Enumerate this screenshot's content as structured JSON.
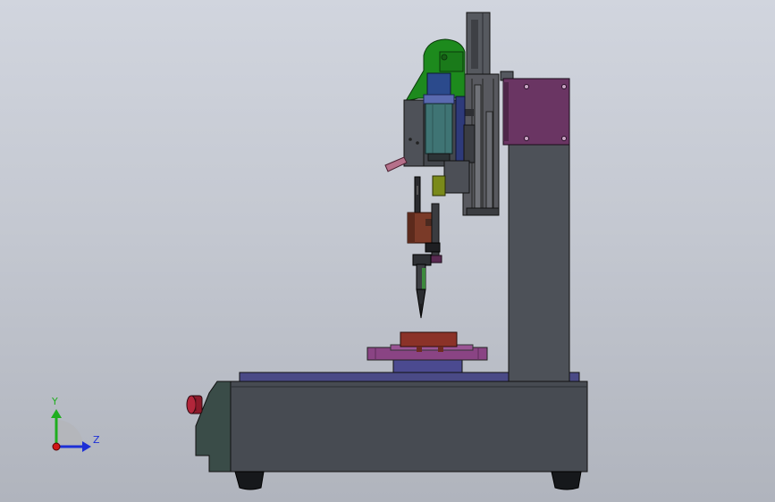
{
  "viewport": {
    "background_top": "#d1d5de",
    "background_bottom": "#b0b4bd"
  },
  "triad": {
    "y_label": "Y",
    "z_label": "Z",
    "y_color": "#1fae1f",
    "z_color": "#1d2fd6",
    "x_color": "#d01818"
  },
  "model": {
    "base_color": "#474b52",
    "column_color": "#4d5158",
    "plate_color": "#4a4a86",
    "motor_mount_color": "#6a3563",
    "cover_color": "#1d8a1d",
    "fixture_color": "#8a4484",
    "workpiece_color": "#8b3228",
    "estop_color": "#8c1a2a"
  }
}
